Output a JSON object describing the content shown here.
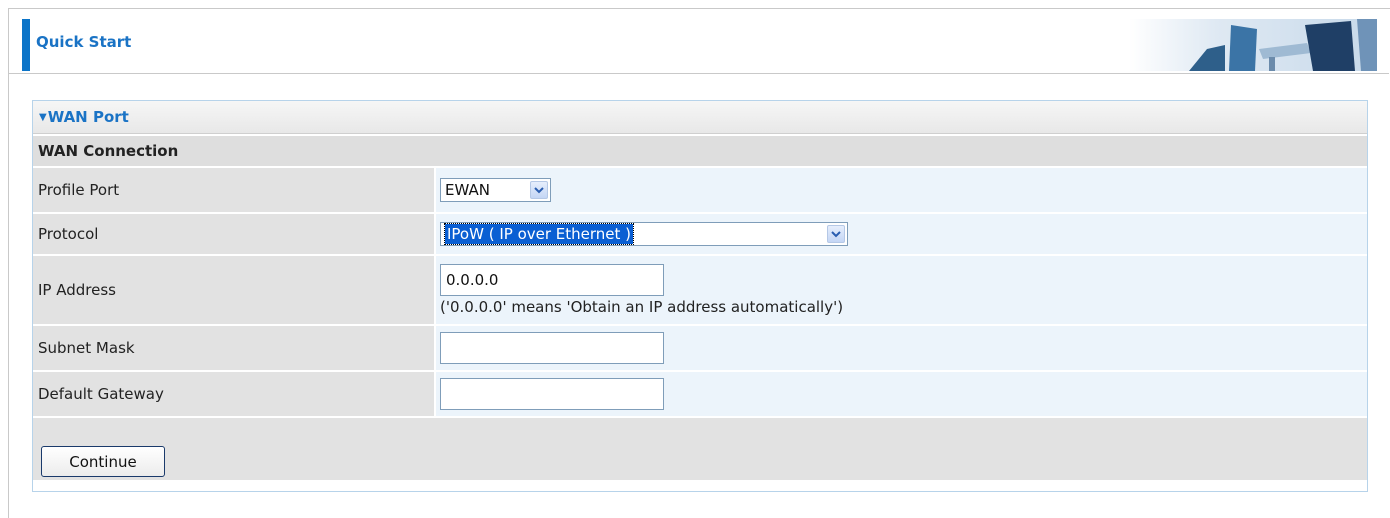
{
  "header": {
    "title": "Quick Start"
  },
  "section": {
    "title": "WAN Port"
  },
  "subsection": {
    "title": "WAN Connection"
  },
  "fields": {
    "profile_port": {
      "label": "Profile Port",
      "value": "EWAN"
    },
    "protocol": {
      "label": "Protocol",
      "value": "IPoW ( IP over Ethernet )"
    },
    "ip_address": {
      "label": "IP Address",
      "value": "0.0.0.0",
      "hint": "('0.0.0.0' means 'Obtain an IP address automatically')"
    },
    "subnet_mask": {
      "label": "Subnet Mask",
      "value": ""
    },
    "default_gateway": {
      "label": "Default Gateway",
      "value": ""
    }
  },
  "buttons": {
    "continue_label": "Continue"
  },
  "colors": {
    "accent": "#1a73c5",
    "header_bar": "#0b74c8",
    "label_bg": "#e2e2e2",
    "value_bg": "#ecf4fb"
  },
  "icons": {
    "section_toggle": "caret-down-icon",
    "dropdown": "chevron-down-icon"
  }
}
